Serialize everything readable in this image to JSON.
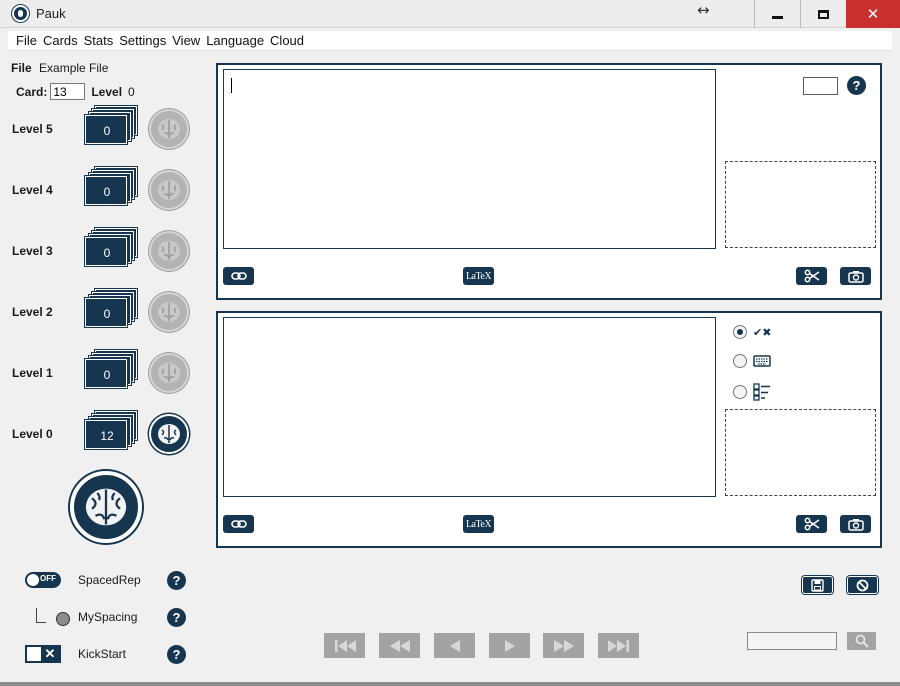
{
  "window": {
    "title": "Pauk",
    "resize_glyph": "↔",
    "close_glyph": "✕"
  },
  "menu": {
    "items": [
      "File",
      "Cards",
      "Stats",
      "Settings",
      "View",
      "Language",
      "Cloud"
    ]
  },
  "file": {
    "label": "File",
    "name": "Example File",
    "card_label": "Card:",
    "card_value": "13",
    "level_label": "Level",
    "level_value": "0"
  },
  "levels": [
    {
      "label": "Level 5",
      "count": "0",
      "enabled": false
    },
    {
      "label": "Level 4",
      "count": "0",
      "enabled": false
    },
    {
      "label": "Level 3",
      "count": "0",
      "enabled": false
    },
    {
      "label": "Level 2",
      "count": "0",
      "enabled": false
    },
    {
      "label": "Level 1",
      "count": "0",
      "enabled": false
    },
    {
      "label": "Level 0",
      "count": "12",
      "enabled": true
    }
  ],
  "options": {
    "spaced_rep_label": "SpacedRep",
    "spaced_rep_toggle": "OFF",
    "my_spacing_label": "MySpacing",
    "kickstart_label": "KickStart",
    "help": "?"
  },
  "front": {
    "help": "?",
    "latex_label": "LaTeX"
  },
  "back": {
    "latex_label": "LaTeX",
    "answer_modes": [
      "check-cross-icon",
      "keyboard-icon",
      "checklist-icon"
    ],
    "selected_mode": 0
  },
  "colors": {
    "accent": "#16354f",
    "disabled": "#a3a3a3",
    "close": "#c8302f"
  }
}
